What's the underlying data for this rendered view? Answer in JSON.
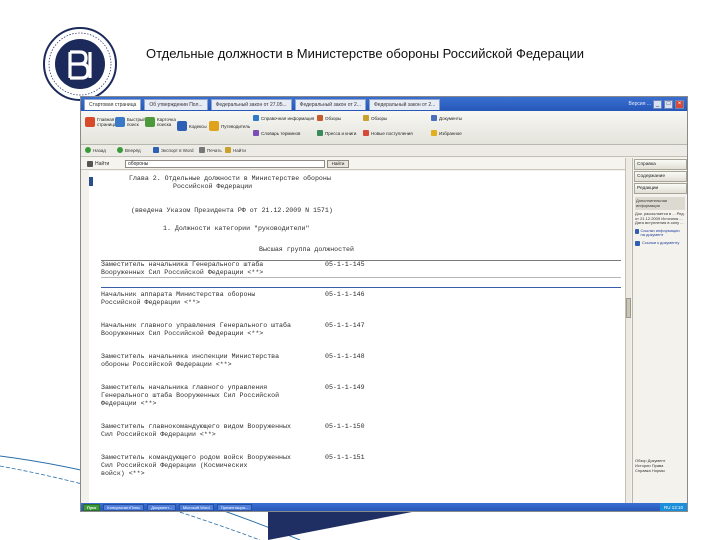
{
  "slide": {
    "title": "Отдельные должности в Министерстве обороны Российской Федерации",
    "colors": {
      "logo": "#1b2a5a",
      "deco_line": "#2a6fa8",
      "deco_arrow": "#1f2f63"
    }
  },
  "app": {
    "tabs": [
      {
        "label": "Стартовая страница"
      },
      {
        "label": "Об утверждении Пол..."
      },
      {
        "label": "Федеральный закон от 27.05..."
      },
      {
        "label": "Федеральный закон от 2..."
      },
      {
        "label": "Федеральный закон от 2..."
      }
    ],
    "titlebar_right": "Версия ...",
    "ribbon": [
      {
        "label": "Главная страница",
        "icon": "home-icon",
        "color": "#d74a2a"
      },
      {
        "label": "Быстрый поиск",
        "icon": "search-icon",
        "color": "#3a78c8"
      },
      {
        "label": "Карточка поиска",
        "icon": "card-icon",
        "color": "#4c9a3c"
      },
      {
        "label": "Кодексы",
        "icon": "books-icon",
        "color": "#2d5fb5"
      },
      {
        "label": "Путеводитель",
        "icon": "compass-icon",
        "color": "#e1a21b"
      },
      {
        "label": "Справочная информация",
        "icon": "info-icon",
        "color": "#2d7ac8"
      },
      {
        "label": "Словарь терминов",
        "icon": "dictionary-icon",
        "color": "#7b4fb5"
      },
      {
        "label": "Обзоры",
        "icon": "review-icon",
        "color": "#c85a2d"
      },
      {
        "label": "Пресса и книги",
        "icon": "press-icon",
        "color": "#3c8a5a"
      },
      {
        "label": "Обзоры",
        "icon": "overview-icon",
        "color": "#c8a22d"
      },
      {
        "label": "Новые поступления",
        "icon": "new-icon",
        "color": "#d64a3a"
      },
      {
        "label": "Документы",
        "icon": "documents-icon",
        "color": "#4a6fbf"
      },
      {
        "label": "Избранное",
        "icon": "star-icon",
        "color": "#e0b020"
      }
    ],
    "addressbar": [
      {
        "label": "Назад",
        "icon": "back-icon"
      },
      {
        "label": "Вперёд",
        "icon": "forward-icon"
      },
      {
        "label": "Экспорт в Word",
        "icon": "word-icon"
      },
      {
        "label": "Печать",
        "icon": "print-icon"
      },
      {
        "label": "Найти",
        "icon": "find-icon"
      }
    ],
    "search": {
      "label": "Найти",
      "value": "обороны",
      "button": "Найти"
    },
    "document": {
      "header": [
        "Глава 2. Отдельные должности в Министерстве обороны",
        "Российской Федерации"
      ],
      "amendment": "(введена Указом Президента РФ от 21.12.2009 N 1571)",
      "section": "1. Должности категории \"руководители\"",
      "group": "Высшая группа должностей",
      "entries": [
        {
          "lines": [
            "Заместитель начальника Генерального штаба",
            "Вооруженных Сил Российской Федерации <**>"
          ],
          "code": "05-1-1-145"
        },
        {
          "lines": [
            "Начальник аппарата Министерства обороны",
            "Российской Федерации <**>"
          ],
          "code": "05-1-1-146"
        },
        {
          "lines": [
            "Начальник главного управления Генерального штаба",
            "Вооруженных Сил Российской Федерации <**>"
          ],
          "code": "05-1-1-147"
        },
        {
          "lines": [
            "Заместитель начальника инспекции Министерства",
            "обороны Российской Федерации <**>"
          ],
          "code": "05-1-1-148"
        },
        {
          "lines": [
            "Заместитель начальника главного управления",
            "Генерального штаба Вооруженных Сил Российской",
            "Федерации <**>"
          ],
          "code": "05-1-1-149"
        },
        {
          "lines": [
            "Заместитель главнокомандующего видом Вооруженных",
            "Сил Российской Федерации <**>"
          ],
          "code": "05-1-1-150"
        },
        {
          "lines": [
            "Заместитель командующего родом войск Вооруженных",
            "Сил Российской Федерации (Космических",
            "войск) <**>"
          ],
          "code": "05-1-1-151"
        }
      ]
    },
    "right_panel": {
      "tabs": [
        "Справка",
        "Содержание",
        "Редакции"
      ],
      "header": "Дополнительная информация",
      "text": "Док. рассылается в ... Ред. от 21.12.2009 Источник ... Дата вступления в силу ...",
      "links": [
        "Ссылки информации на документ",
        "Ссылки к документу"
      ],
      "bottom": [
        "Обзор",
        "Документ",
        "Истории",
        "Права",
        "Справка",
        "Нормы"
      ]
    },
    "taskbar": {
      "start": "Пуск",
      "items": [
        "КонсультантПлюс",
        "Документ...",
        "Microsoft Word",
        "Презентация..."
      ],
      "tray": "RU 13:10"
    }
  }
}
